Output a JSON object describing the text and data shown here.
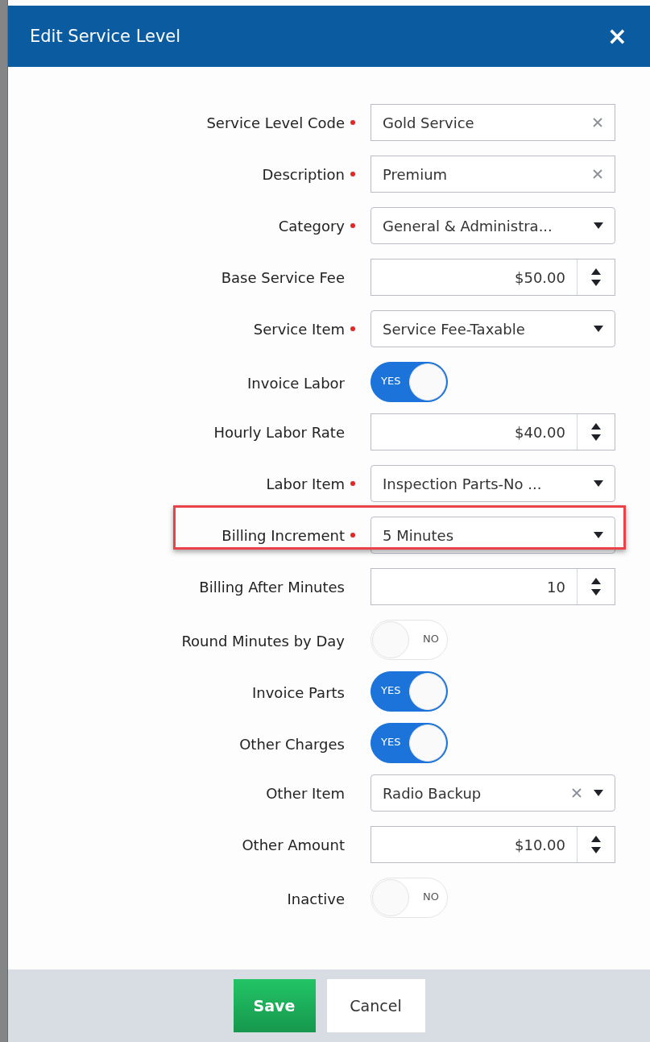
{
  "dialog": {
    "title": "Edit Service Level",
    "close": "×"
  },
  "fields": [
    {
      "kind": "text",
      "label": "Service Level Code",
      "required": true,
      "value": "Gold Service",
      "clearable": true
    },
    {
      "kind": "text",
      "label": "Description",
      "required": true,
      "value": "Premium",
      "clearable": true
    },
    {
      "kind": "select",
      "label": "Category",
      "required": true,
      "value": "General & Administra...",
      "clearable": false
    },
    {
      "kind": "number",
      "label": "Base Service Fee",
      "required": false,
      "value": "$50.00"
    },
    {
      "kind": "select",
      "label": "Service Item",
      "required": true,
      "value": "Service Fee-Taxable",
      "clearable": false
    },
    {
      "kind": "toggle",
      "label": "Invoice Labor",
      "on": true,
      "text": "YES"
    },
    {
      "kind": "number",
      "label": "Hourly Labor Rate",
      "required": false,
      "value": "$40.00"
    },
    {
      "kind": "select",
      "label": "Labor Item",
      "required": true,
      "value": "Inspection Parts-No ...",
      "clearable": false
    },
    {
      "kind": "select",
      "label": "Billing Increment",
      "required": true,
      "value": "5 Minutes",
      "clearable": false,
      "highlighted": true
    },
    {
      "kind": "number",
      "label": "Billing After Minutes",
      "required": false,
      "value": "10"
    },
    {
      "kind": "toggle",
      "label": "Round Minutes by Day",
      "on": false,
      "text": "NO"
    },
    {
      "kind": "toggle",
      "label": "Invoice Parts",
      "on": true,
      "text": "YES"
    },
    {
      "kind": "toggle",
      "label": "Other Charges",
      "on": true,
      "text": "YES"
    },
    {
      "kind": "select",
      "label": "Other Item",
      "required": false,
      "value": "Radio Backup",
      "clearable": true
    },
    {
      "kind": "number",
      "label": "Other Amount",
      "required": false,
      "value": "$10.00"
    },
    {
      "kind": "toggle",
      "label": "Inactive",
      "on": false,
      "text": "NO"
    }
  ],
  "buttons": [
    {
      "label": "Save",
      "kind": "primary"
    },
    {
      "label": "Cancel",
      "kind": "secondary"
    }
  ]
}
